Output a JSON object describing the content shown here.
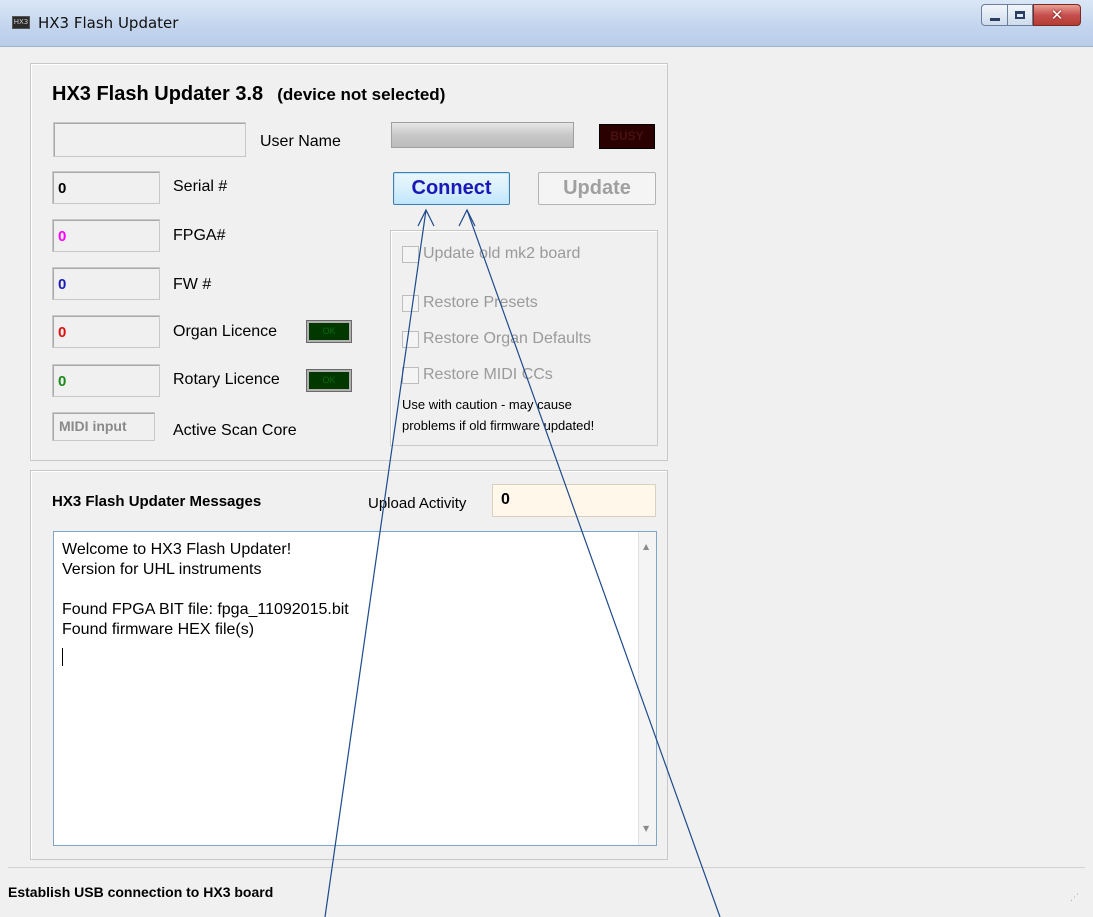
{
  "window": {
    "title": "HX3 Flash Updater",
    "icon_text": "HX3"
  },
  "header": {
    "title": "HX3 Flash Updater 3.8",
    "subtitle": "(device not selected)"
  },
  "device": {
    "user_name_value": "",
    "user_name_label": "User Name",
    "serial_value": "0",
    "serial_label": "Serial #",
    "fpga_value": "0",
    "fpga_label": "FPGA#",
    "fw_value": "0",
    "fw_label": "FW #",
    "organ_licence_value": "0",
    "organ_licence_label": "Organ Licence",
    "organ_licence_led": "OK",
    "rotary_licence_value": "0",
    "rotary_licence_label": "Rotary Licence",
    "rotary_licence_led": "OK",
    "midi_input": "MIDI input",
    "active_scan_label": "Active Scan Core"
  },
  "status_led": "BUSY",
  "buttons": {
    "connect": "Connect",
    "update": "Update"
  },
  "options": {
    "update_old_mk2": "Update old mk2 board",
    "restore_presets": "Restore Presets",
    "restore_organ_defaults": "Restore Organ Defaults",
    "restore_midi_ccs": "Restore MIDI CCs",
    "caution_line1": "Use with caution - may cause",
    "caution_line2": "problems if old firmware updated!"
  },
  "messages": {
    "title": "HX3 Flash Updater Messages",
    "upload_label": "Upload Activity",
    "upload_value": "0",
    "text": "Welcome to HX3 Flash Updater!\nVersion for UHL instruments\n\nFound FPGA BIT file: fpga_11092015.bit\nFound firmware HEX file(s)"
  },
  "statusbar": {
    "text": "Establish USB connection to HX3 board"
  },
  "colors": {
    "fpga_value": "#ff00ff",
    "fw_value": "#1a1ab8",
    "organ_value": "#e01010",
    "rotary_value": "#1a8a1a",
    "connect_text": "#1a18b8",
    "annotation_lines": "#1e4a8a"
  }
}
